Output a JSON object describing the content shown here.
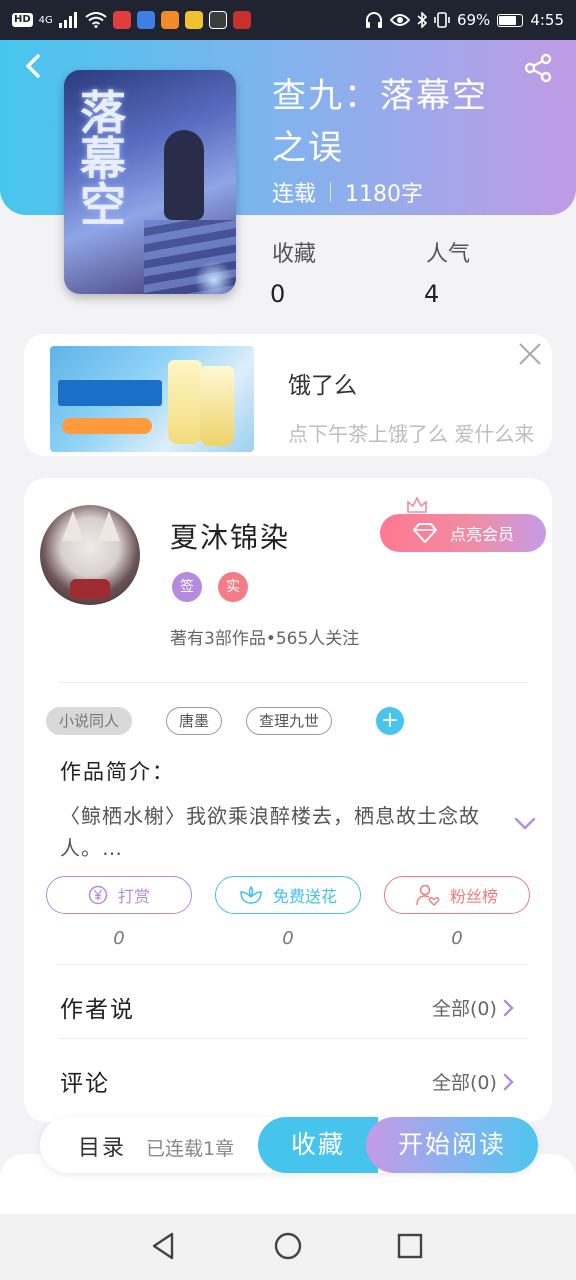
{
  "status_bar": {
    "hd": "HD",
    "network": "4G",
    "battery_pct": "69%",
    "time": "4:55"
  },
  "book": {
    "title": "查九：落幕空之误",
    "status": "连载",
    "word_count": "1180字",
    "stats": [
      {
        "label": "收藏",
        "value": "0"
      },
      {
        "label": "人气",
        "value": "4"
      }
    ]
  },
  "ad": {
    "title": "饿了么",
    "description": "点下午茶上饿了么 爱什么来"
  },
  "author": {
    "name": "夏沐锦染",
    "badges": [
      "签",
      "实"
    ],
    "stats": "著有3部作品•565人关注",
    "vip_label": "点亮会员"
  },
  "tags": [
    "小说同人",
    "唐墨",
    "查理九世"
  ],
  "intro": {
    "heading": "作品简介：",
    "text": "〈鲸栖水榭〉我欲乘浪醉楼去，栖息故土念故人。…"
  },
  "actions": [
    {
      "label": "打赏",
      "count": "0",
      "color": "#b58be0"
    },
    {
      "label": "免费送花",
      "count": "0",
      "color": "#42c1ea"
    },
    {
      "label": "粉丝榜",
      "count": "0",
      "color": "#ee7d7d"
    }
  ],
  "rows": [
    {
      "label": "作者说",
      "more": "全部(0)"
    },
    {
      "label": "评论",
      "more": "全部(0)"
    }
  ],
  "bottom": {
    "toc_label": "目录",
    "toc_count": "已连载1章",
    "favorite_label": "收藏",
    "read_label": "开始阅读"
  },
  "colors": {
    "header_start": "#46c6ee",
    "header_end": "#c19be6",
    "accent_blue": "#46c4ee",
    "vip_pink": "#ff7893"
  }
}
